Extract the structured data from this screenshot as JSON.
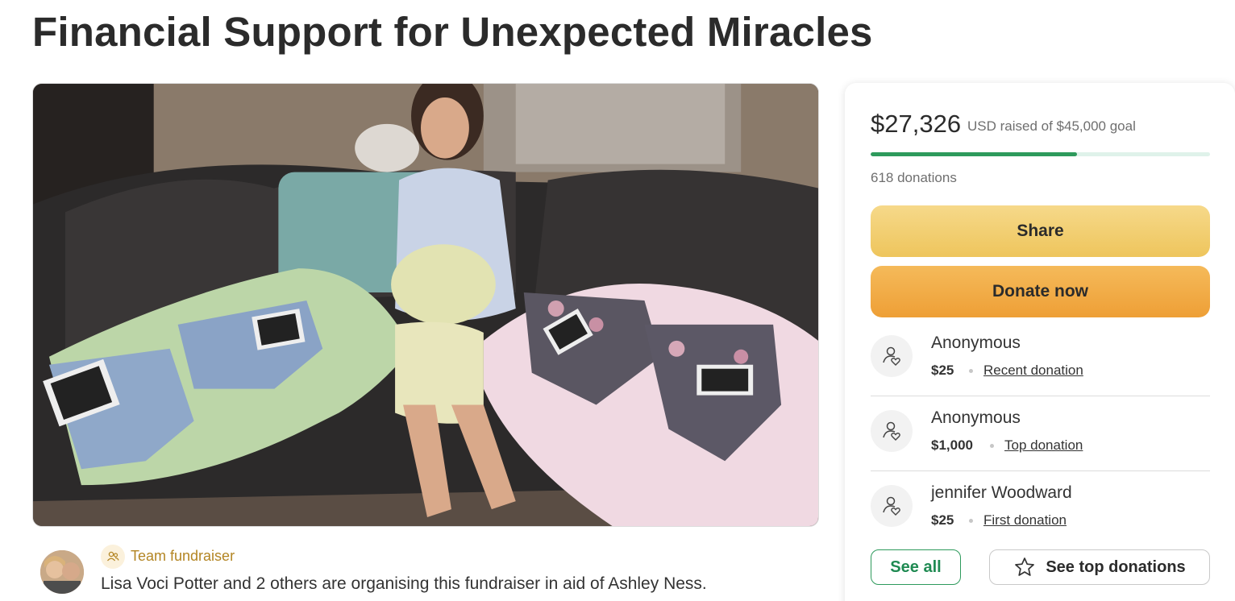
{
  "page": {
    "title": "Financial Support for Unexpected Miracles"
  },
  "hero": {
    "alt": "Pregnant woman seated on a sofa with baby outfits and ultrasound photos"
  },
  "organizer": {
    "badge_label": "Team fundraiser",
    "text": "Lisa Voci Potter and 2 others are organising this fundraiser in aid of Ashley Ness."
  },
  "progress": {
    "raised": "$27,326",
    "goal_text": "USD raised of $45,000 goal",
    "fraction": 0.607,
    "donations_count": "618 donations"
  },
  "actions": {
    "share_label": "Share",
    "donate_label": "Donate now"
  },
  "donations": [
    {
      "name": "Anonymous",
      "amount": "$25",
      "tag": "Recent donation"
    },
    {
      "name": "Anonymous",
      "amount": "$1,000",
      "tag": "Top donation"
    },
    {
      "name": "jennifer Woodward",
      "amount": "$25",
      "tag": "First donation"
    }
  ],
  "footer_buttons": {
    "see_all_label": "See all",
    "see_top_label": "See top donations"
  },
  "colors": {
    "accent_green": "#2e9a5c",
    "share_yellow": "#eec55c",
    "donate_orange": "#ee9f36",
    "team_gold": "#b38523"
  },
  "icons": {
    "team": "team-people-icon",
    "donor": "donor-heart-icon",
    "star": "star-icon"
  }
}
